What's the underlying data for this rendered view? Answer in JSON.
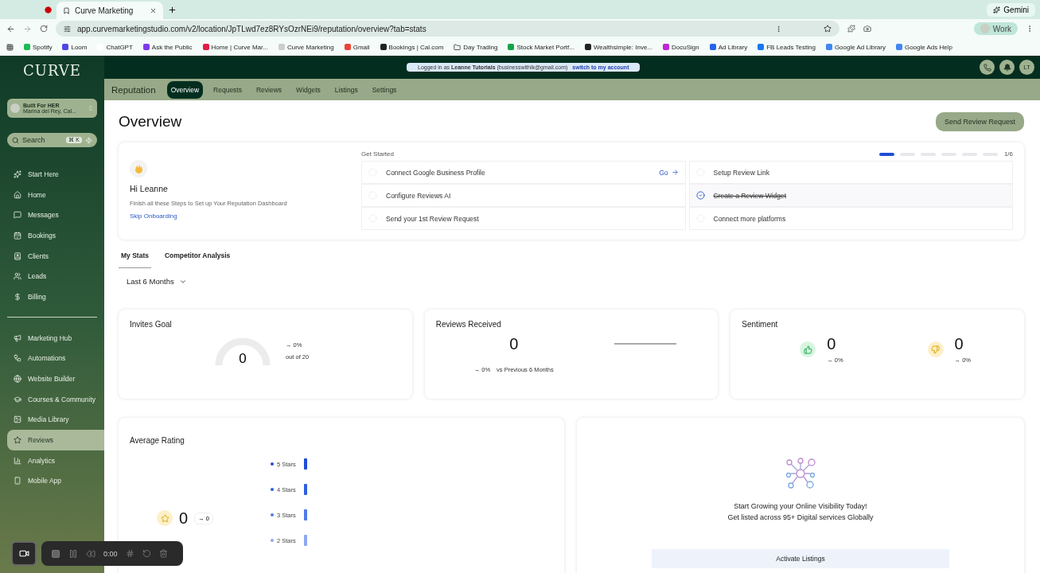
{
  "browser": {
    "tabs": [
      {
        "title": "Curve Marketing",
        "selected": true
      }
    ],
    "url": "app.curvemarketingstudio.com/v2/location/JpTLwd7ez8RYsOzrNEi9/reputation/overview?tab=stats",
    "gemini": "Gemini",
    "profile": "Work",
    "bookmarks": [
      "Spotify",
      "Loom",
      "ChatGPT",
      "Ask the Public",
      "Home | Curve Mar...",
      "Curve Marketing",
      "Gmail",
      "Bookings | Cal.com",
      "Day Trading",
      "Stock Market Portf...",
      "Wealthsimple: Inve...",
      "DocuSign",
      "Ad Library",
      "FB Leads Testing",
      "Google Ad Library",
      "Google Ads Help"
    ]
  },
  "sidebar": {
    "logo": "CURVE",
    "account": {
      "name": "Built For HER",
      "location": "Marina del Rey, Cal..."
    },
    "search": {
      "placeholder": "Search",
      "shortcut": "⌘ K"
    },
    "items": [
      {
        "label": "Start Here",
        "selected": false
      },
      {
        "label": "Home",
        "selected": false
      },
      {
        "label": "Messages",
        "selected": false
      },
      {
        "label": "Bookings",
        "selected": false
      },
      {
        "label": "Clients",
        "selected": false
      },
      {
        "label": "Leads",
        "selected": false
      },
      {
        "label": "Billing",
        "selected": false
      }
    ],
    "items2": [
      {
        "label": "Marketing Hub",
        "selected": false
      },
      {
        "label": "Automations",
        "selected": false
      },
      {
        "label": "Website Builder",
        "selected": false
      },
      {
        "label": "Courses & Community",
        "selected": false
      },
      {
        "label": "Media Library",
        "selected": false
      },
      {
        "label": "Reviews",
        "selected": true
      },
      {
        "label": "Analytics",
        "selected": false
      },
      {
        "label": "Mobile App",
        "selected": false
      }
    ]
  },
  "topbar": {
    "logged_in": "Logged in as **Leanne Tutorials** (businesswithlk@gmail.com)",
    "switch_link": "switch to my account",
    "avatar": "LT"
  },
  "subnav": {
    "title": "Reputation",
    "tabs": [
      {
        "label": "Overview",
        "selected": true
      },
      {
        "label": "Requests",
        "selected": false
      },
      {
        "label": "Reviews",
        "selected": false
      },
      {
        "label": "Widgets",
        "selected": false
      },
      {
        "label": "Listings",
        "selected": false
      },
      {
        "label": "Settings",
        "selected": false
      }
    ]
  },
  "page": {
    "title": "Overview",
    "primary_button": "Send Review Request"
  },
  "onboarding": {
    "greeting": "Hi Leanne",
    "subtitle": "Finish all these Steps to Set up Your Reputation Dashboard",
    "skip": "Skip Onboarding",
    "get_started": "Get Started",
    "page_count": "1/6",
    "pages": [
      {
        "selected": true
      },
      {
        "selected": false
      },
      {
        "selected": false
      },
      {
        "selected": false
      },
      {
        "selected": false
      },
      {
        "selected": false
      }
    ],
    "tasks": [
      {
        "label": "Connect Google Business Profile",
        "checked": false,
        "action": "Go"
      },
      {
        "label": "Setup Review Link",
        "checked": false
      },
      {
        "label": "Configure Reviews AI",
        "checked": false
      },
      {
        "label": "Create a Review Widget",
        "checked": true
      },
      {
        "label": "Send your 1st Review Request",
        "checked": false
      },
      {
        "label": "Connect more platforms",
        "checked": false
      }
    ]
  },
  "stats_tabs": [
    {
      "label": "My Stats",
      "selected": true
    },
    {
      "label": "Competitor Analysis",
      "selected": false
    }
  ],
  "period": "Last 6 Months",
  "invites_goal": {
    "title": "Invites Goal",
    "value": "0",
    "change": "→ 0%",
    "goal": "out of 20"
  },
  "reviews_received": {
    "title": "Reviews Received",
    "value": "0",
    "change": "→ 0%",
    "compare": "vs Previous 6 Months"
  },
  "sentiment": {
    "title": "Sentiment",
    "items": [
      {
        "kind": "positive",
        "value": "0",
        "change": "→ 0%"
      },
      {
        "kind": "negative",
        "value": "0",
        "change": "→ 0%"
      }
    ]
  },
  "average_rating": {
    "title": "Average Rating",
    "value": "0",
    "change": "→ 0",
    "rows": [
      {
        "label": "5 Stars",
        "color": "#1d4ed8"
      },
      {
        "label": "4 Stars",
        "color": "#2f5fe0"
      },
      {
        "label": "3 Stars",
        "color": "#4f7be8"
      },
      {
        "label": "2 Stars",
        "color": "#8ea8ef"
      }
    ]
  },
  "listings": {
    "heading": "Start Growing your Online Visibility Today!",
    "text": "Get listed across 95+ Digital services Globally",
    "button": "Activate Listings"
  },
  "recorder": {
    "time": "0:00"
  }
}
